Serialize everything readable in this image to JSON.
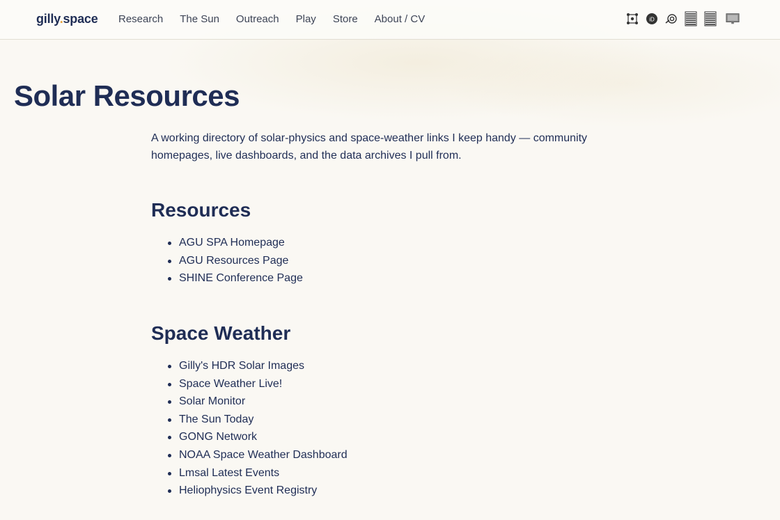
{
  "header": {
    "brand_prefix": "gilly",
    "brand_dot": ".",
    "brand_suffix": "space",
    "nav": [
      {
        "label": "Research"
      },
      {
        "label": "The Sun"
      },
      {
        "label": "Outreach"
      },
      {
        "label": "Play"
      },
      {
        "label": "Store"
      },
      {
        "label": "About / CV"
      }
    ],
    "icons": [
      "network-icon",
      "orcid-icon",
      "ads-icon",
      "document-icon",
      "document-alt-icon",
      "monitor-icon"
    ]
  },
  "main": {
    "title": "Solar Resources",
    "intro": "A working directory of solar-physics and space-weather links I keep handy — community homepages, live dashboards, and the data archives I pull from.",
    "sections": [
      {
        "heading": "Resources",
        "items": [
          "AGU SPA Homepage",
          "AGU Resources Page",
          "SHINE Conference Page"
        ]
      },
      {
        "heading": "Space Weather",
        "items": [
          "Gilly's HDR Solar Images",
          "Space Weather Live!",
          "Solar Monitor",
          "The Sun Today",
          "GONG Network",
          "NOAA Space Weather Dashboard",
          "Lmsal Latest Events",
          "Heliophysics Event Registry"
        ]
      }
    ]
  },
  "colors": {
    "text": "#1f2d55",
    "accent": "#e8a33a",
    "background": "#faf8f3"
  }
}
